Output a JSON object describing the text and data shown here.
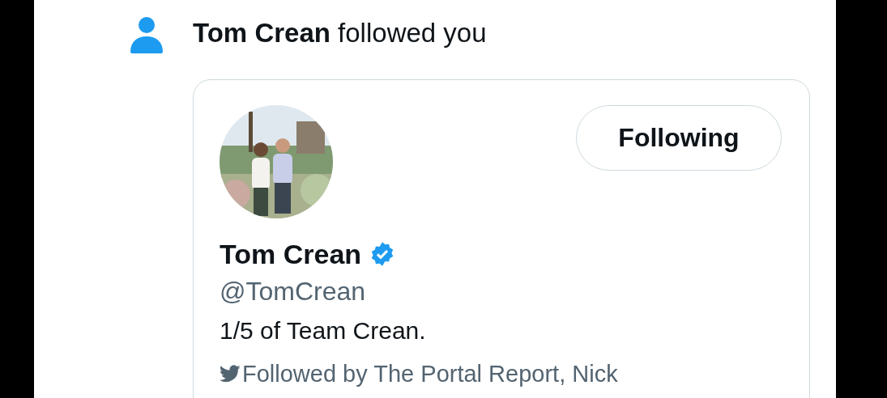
{
  "notification": {
    "actor": "Tom Crean",
    "text": "followed you"
  },
  "card": {
    "button": {
      "label": "Following"
    },
    "name": "Tom Crean",
    "verified": true,
    "handle": "@TomCrean",
    "bio": "1/5 of Team Crean.",
    "followed_by": "Followed by The Portal Report, Nick"
  }
}
